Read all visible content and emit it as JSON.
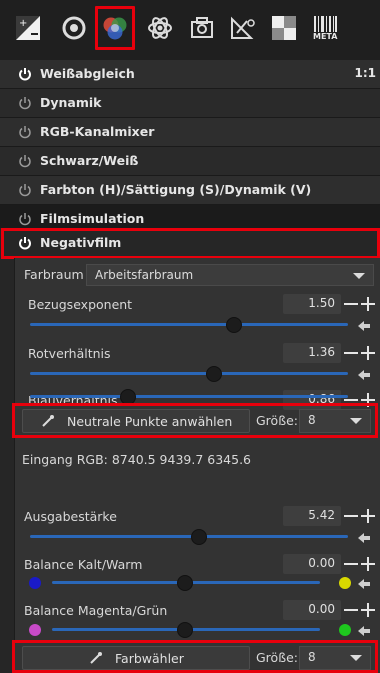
{
  "toolbar": {
    "tabs": [
      {
        "icon": "exposure-icon",
        "active": false
      },
      {
        "icon": "detail-icon",
        "active": false
      },
      {
        "icon": "color-icon",
        "active": true
      },
      {
        "icon": "advanced-icon",
        "active": false
      },
      {
        "icon": "transform-icon",
        "active": false
      },
      {
        "icon": "raw-icon",
        "active": false
      },
      {
        "icon": "favorites-icon",
        "active": false
      },
      {
        "icon": "meta-barcode-icon",
        "active": false,
        "label": "META"
      }
    ]
  },
  "tools": [
    {
      "label": "Weißabgleich",
      "ratio": "1:1",
      "enabled": true
    },
    {
      "label": "Dynamik",
      "enabled": false
    },
    {
      "label": "RGB-Kanalmixer",
      "enabled": false
    },
    {
      "label": "Schwarz/Weiß",
      "enabled": false
    },
    {
      "label": "Farbton (H)/Sättigung (S)/Dynamik (V)",
      "enabled": false
    },
    {
      "label": "Filmsimulation",
      "enabled": false
    },
    {
      "label": "Negativfilm",
      "enabled": true
    }
  ],
  "negativfilm": {
    "farbraum_label": "Farbraum",
    "farbraum_value": "Arbeitsfarbraum",
    "bezugsexponent": {
      "label": "Bezugsexponent",
      "value": "1.50",
      "position": 0.72
    },
    "rotverhaeltnis": {
      "label": "Rotverhältnis",
      "value": "1.36",
      "position": 0.65
    },
    "blauverhaeltnis": {
      "label": "Blauverhältnis",
      "value": "0.86",
      "position": 0.33
    },
    "pick_button": "Neutrale Punkte anwählen",
    "size_label": "Größe:",
    "size_value": "8",
    "eingang_rgb": "Eingang RGB: 8740.5 9439.7 6345.6",
    "ausgabestaerke": {
      "label": "Ausgabestärke",
      "value": "5.42",
      "position": 0.55
    },
    "balance_kalt_warm": {
      "label": "Balance Kalt/Warm",
      "value": "0.00",
      "position": 0.5
    },
    "balance_magenta_gruen": {
      "label": "Balance Magenta/Grün",
      "value": "0.00",
      "position": 0.5
    },
    "farbwaehler_button": "Farbwähler",
    "size_label_2": "Größe:",
    "size_value_2": "8"
  },
  "colors": {
    "highlight_red": "#e8000c",
    "slider_blue": "#2a67b8",
    "cold_blue": "#1a1ac8",
    "warm_yellow": "#d8d800",
    "magenta": "#c84ac8",
    "green": "#1ec81e"
  }
}
